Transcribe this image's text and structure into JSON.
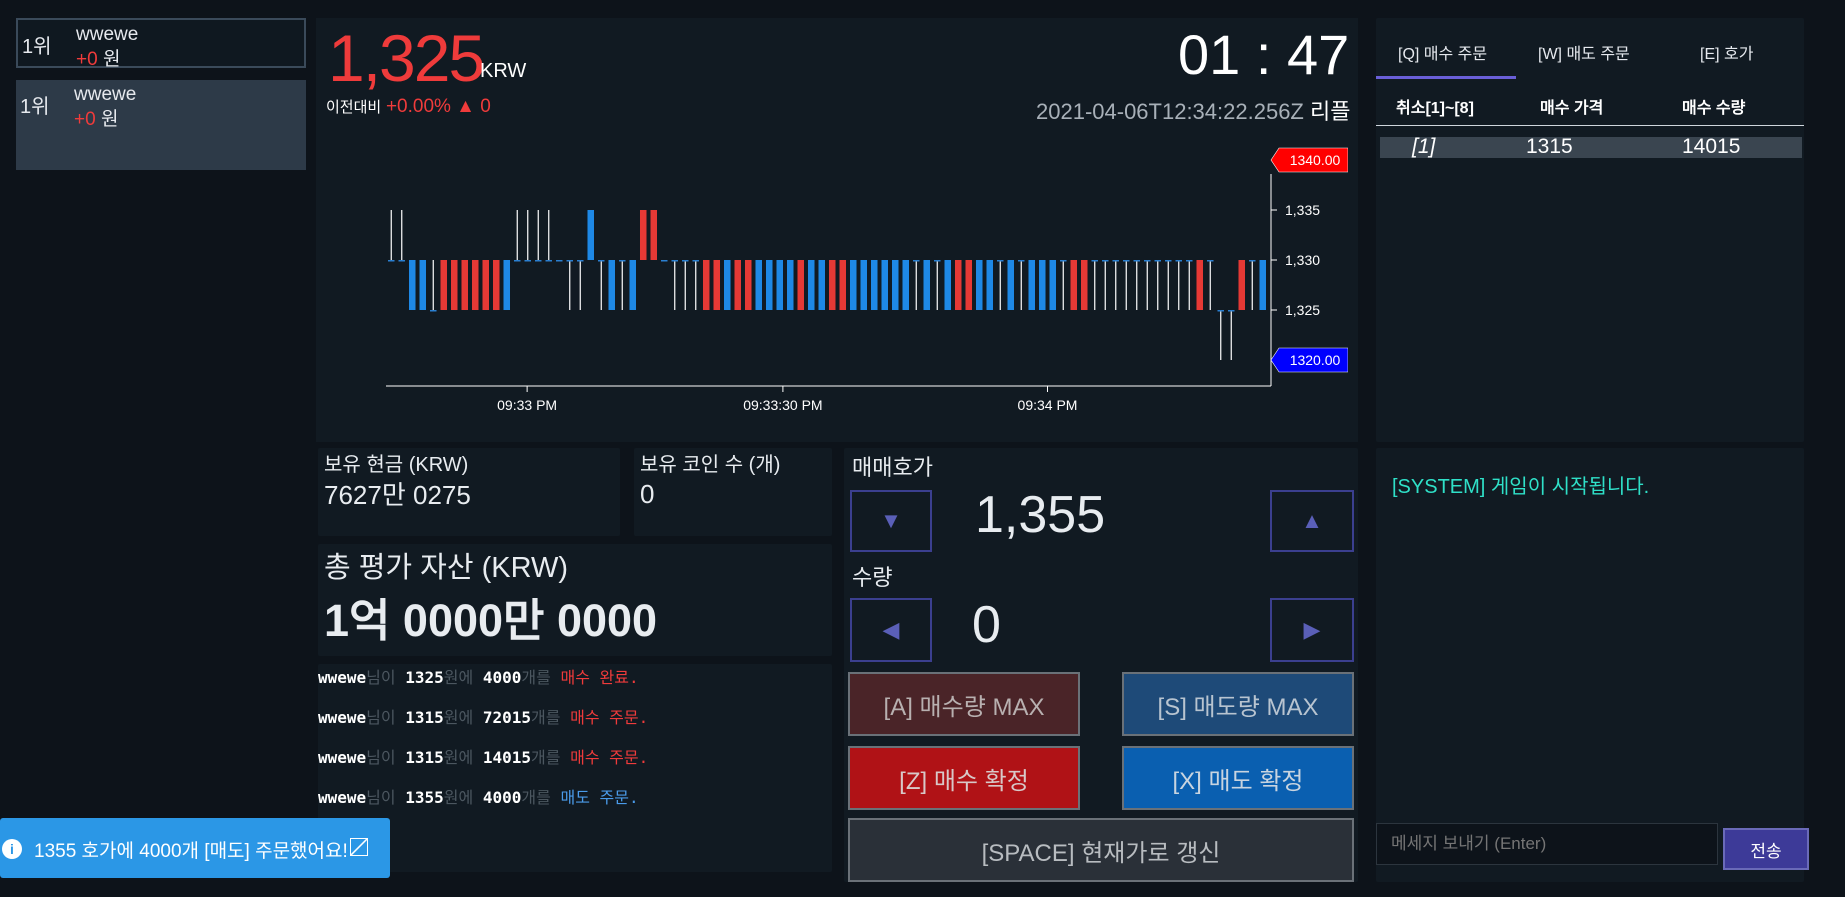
{
  "ranking": [
    {
      "rank": "1위",
      "name": "wwewe",
      "change": "+0",
      "unit": "원"
    },
    {
      "rank": "1위",
      "name": "wwewe",
      "change": "+0",
      "unit": "원"
    }
  ],
  "ticker": {
    "price": "1,325",
    "currency": "KRW",
    "prev_label": "이전대비",
    "prev_change": "+0.00% ▲ 0",
    "timer": "01 : 47",
    "timestamp": "2021-04-06T12:34:22.256Z",
    "coin_name": "리플"
  },
  "chart_data": {
    "type": "candlestick",
    "y_ticks": [
      "1,335",
      "1,330",
      "1,325"
    ],
    "x_ticks": [
      "09:33 PM",
      "09:33:30 PM",
      "09:34 PM"
    ],
    "ylim": [
      1318,
      1342
    ],
    "high_marker": "1340.00",
    "low_marker": "1320.00",
    "colors": {
      "up": "#e53935",
      "down": "#1e88e5",
      "neutral": "#ffffff"
    },
    "candles": [
      {
        "o": 1330,
        "c": 1330,
        "h": 1335,
        "l": 1330
      },
      {
        "o": 1330,
        "c": 1330,
        "h": 1335,
        "l": 1330
      },
      {
        "o": 1330,
        "c": 1325,
        "h": 1330,
        "l": 1325
      },
      {
        "o": 1330,
        "c": 1325,
        "h": 1330,
        "l": 1325
      },
      {
        "o": 1325,
        "c": 1325,
        "h": 1330,
        "l": 1325
      },
      {
        "o": 1325,
        "c": 1330,
        "h": 1330,
        "l": 1325
      },
      {
        "o": 1325,
        "c": 1330,
        "h": 1330,
        "l": 1325
      },
      {
        "o": 1325,
        "c": 1330,
        "h": 1330,
        "l": 1325
      },
      {
        "o": 1325,
        "c": 1330,
        "h": 1330,
        "l": 1325
      },
      {
        "o": 1325,
        "c": 1330,
        "h": 1330,
        "l": 1325
      },
      {
        "o": 1325,
        "c": 1330,
        "h": 1330,
        "l": 1325
      },
      {
        "o": 1330,
        "c": 1325,
        "h": 1330,
        "l": 1325
      },
      {
        "o": 1330,
        "c": 1330,
        "h": 1335,
        "l": 1330
      },
      {
        "o": 1330,
        "c": 1330,
        "h": 1335,
        "l": 1330
      },
      {
        "o": 1330,
        "c": 1330,
        "h": 1335,
        "l": 1330
      },
      {
        "o": 1330,
        "c": 1330,
        "h": 1335,
        "l": 1330
      },
      {
        "o": 1330,
        "c": 1330,
        "h": 1330,
        "l": 1330
      },
      {
        "o": 1330,
        "c": 1330,
        "h": 1330,
        "l": 1325
      },
      {
        "o": 1330,
        "c": 1330,
        "h": 1330,
        "l": 1325
      },
      {
        "o": 1335,
        "c": 1330,
        "h": 1335,
        "l": 1330
      },
      {
        "o": 1330,
        "c": 1330,
        "h": 1330,
        "l": 1325
      },
      {
        "o": 1330,
        "c": 1325,
        "h": 1330,
        "l": 1325
      },
      {
        "o": 1330,
        "c": 1330,
        "h": 1330,
        "l": 1325
      },
      {
        "o": 1330,
        "c": 1325,
        "h": 1330,
        "l": 1325
      },
      {
        "o": 1330,
        "c": 1335,
        "h": 1335,
        "l": 1330
      },
      {
        "o": 1330,
        "c": 1335,
        "h": 1335,
        "l": 1330
      },
      {
        "o": 1330,
        "c": 1330,
        "h": 1330,
        "l": 1330
      },
      {
        "o": 1330,
        "c": 1330,
        "h": 1330,
        "l": 1325
      },
      {
        "o": 1330,
        "c": 1330,
        "h": 1330,
        "l": 1325
      },
      {
        "o": 1330,
        "c": 1330,
        "h": 1330,
        "l": 1325
      },
      {
        "o": 1325,
        "c": 1330,
        "h": 1330,
        "l": 1325
      },
      {
        "o": 1325,
        "c": 1330,
        "h": 1330,
        "l": 1325
      },
      {
        "o": 1330,
        "c": 1325,
        "h": 1330,
        "l": 1325
      },
      {
        "o": 1325,
        "c": 1330,
        "h": 1330,
        "l": 1325
      },
      {
        "o": 1325,
        "c": 1330,
        "h": 1330,
        "l": 1325
      },
      {
        "o": 1330,
        "c": 1325,
        "h": 1330,
        "l": 1325
      },
      {
        "o": 1330,
        "c": 1325,
        "h": 1330,
        "l": 1325
      },
      {
        "o": 1330,
        "c": 1325,
        "h": 1330,
        "l": 1325
      },
      {
        "o": 1330,
        "c": 1325,
        "h": 1330,
        "l": 1325
      },
      {
        "o": 1325,
        "c": 1330,
        "h": 1330,
        "l": 1325
      },
      {
        "o": 1330,
        "c": 1325,
        "h": 1330,
        "l": 1325
      },
      {
        "o": 1330,
        "c": 1325,
        "h": 1330,
        "l": 1325
      },
      {
        "o": 1325,
        "c": 1330,
        "h": 1330,
        "l": 1325
      },
      {
        "o": 1325,
        "c": 1330,
        "h": 1330,
        "l": 1325
      },
      {
        "o": 1330,
        "c": 1325,
        "h": 1330,
        "l": 1325
      },
      {
        "o": 1330,
        "c": 1325,
        "h": 1330,
        "l": 1325
      },
      {
        "o": 1330,
        "c": 1325,
        "h": 1330,
        "l": 1325
      },
      {
        "o": 1330,
        "c": 1325,
        "h": 1330,
        "l": 1325
      },
      {
        "o": 1330,
        "c": 1325,
        "h": 1330,
        "l": 1325
      },
      {
        "o": 1330,
        "c": 1325,
        "h": 1330,
        "l": 1325
      },
      {
        "o": 1330,
        "c": 1330,
        "h": 1330,
        "l": 1325
      },
      {
        "o": 1330,
        "c": 1325,
        "h": 1330,
        "l": 1325
      },
      {
        "o": 1330,
        "c": 1330,
        "h": 1330,
        "l": 1325
      },
      {
        "o": 1330,
        "c": 1325,
        "h": 1330,
        "l": 1325
      },
      {
        "o": 1325,
        "c": 1330,
        "h": 1330,
        "l": 1325
      },
      {
        "o": 1325,
        "c": 1330,
        "h": 1330,
        "l": 1325
      },
      {
        "o": 1330,
        "c": 1325,
        "h": 1330,
        "l": 1325
      },
      {
        "o": 1330,
        "c": 1325,
        "h": 1330,
        "l": 1325
      },
      {
        "o": 1330,
        "c": 1330,
        "h": 1330,
        "l": 1325
      },
      {
        "o": 1330,
        "c": 1325,
        "h": 1330,
        "l": 1325
      },
      {
        "o": 1330,
        "c": 1330,
        "h": 1330,
        "l": 1325
      },
      {
        "o": 1330,
        "c": 1325,
        "h": 1330,
        "l": 1325
      },
      {
        "o": 1330,
        "c": 1325,
        "h": 1330,
        "l": 1325
      },
      {
        "o": 1330,
        "c": 1325,
        "h": 1330,
        "l": 1325
      },
      {
        "o": 1330,
        "c": 1330,
        "h": 1330,
        "l": 1325
      },
      {
        "o": 1325,
        "c": 1330,
        "h": 1330,
        "l": 1325
      },
      {
        "o": 1325,
        "c": 1330,
        "h": 1330,
        "l": 1325
      },
      {
        "o": 1330,
        "c": 1330,
        "h": 1330,
        "l": 1325
      },
      {
        "o": 1330,
        "c": 1330,
        "h": 1330,
        "l": 1325
      },
      {
        "o": 1330,
        "c": 1330,
        "h": 1330,
        "l": 1325
      },
      {
        "o": 1330,
        "c": 1330,
        "h": 1330,
        "l": 1325
      },
      {
        "o": 1330,
        "c": 1330,
        "h": 1330,
        "l": 1325
      },
      {
        "o": 1330,
        "c": 1330,
        "h": 1330,
        "l": 1325
      },
      {
        "o": 1330,
        "c": 1330,
        "h": 1330,
        "l": 1325
      },
      {
        "o": 1330,
        "c": 1330,
        "h": 1330,
        "l": 1325
      },
      {
        "o": 1330,
        "c": 1330,
        "h": 1330,
        "l": 1325
      },
      {
        "o": 1330,
        "c": 1330,
        "h": 1330,
        "l": 1325
      },
      {
        "o": 1325,
        "c": 1330,
        "h": 1330,
        "l": 1325
      },
      {
        "o": 1330,
        "c": 1330,
        "h": 1330,
        "l": 1325
      },
      {
        "o": 1325,
        "c": 1325,
        "h": 1325,
        "l": 1320
      },
      {
        "o": 1325,
        "c": 1325,
        "h": 1325,
        "l": 1320
      },
      {
        "o": 1325,
        "c": 1330,
        "h": 1330,
        "l": 1325
      },
      {
        "o": 1330,
        "c": 1330,
        "h": 1330,
        "l": 1325
      },
      {
        "o": 1330,
        "c": 1325,
        "h": 1330,
        "l": 1325
      }
    ]
  },
  "portfolio": {
    "cash_label": "보유 현금 (KRW)",
    "cash_value": "7627만 0275",
    "coins_label": "보유 코인 수 (개)",
    "coins_value": "0",
    "total_label": "총 평가 자산 (KRW)",
    "total_value": "1억 0000만 0000"
  },
  "logs": [
    {
      "user": "wwewe",
      "p1": "님이 ",
      "price": "1325",
      "p2": "원에 ",
      "qty": "4000",
      "p3": "개를 ",
      "action": "매수 완료.",
      "color": "#ef3b3b"
    },
    {
      "user": "wwewe",
      "p1": "님이 ",
      "price": "1315",
      "p2": "원에 ",
      "qty": "72015",
      "p3": "개를 ",
      "action": "매수 주문.",
      "color": "#ef3b3b"
    },
    {
      "user": "wwewe",
      "p1": "님이 ",
      "price": "1315",
      "p2": "원에 ",
      "qty": "14015",
      "p3": "개를 ",
      "action": "매수 주문.",
      "color": "#ef3b3b"
    },
    {
      "user": "wwewe",
      "p1": "님이 ",
      "price": "1355",
      "p2": "원에 ",
      "qty": "4000",
      "p3": "개를 ",
      "action": "매도 주문.",
      "color": "#4a9bea"
    }
  ],
  "trade": {
    "price_label": "매매호가",
    "price_value": "1,355",
    "qty_label": "수량",
    "qty_value": "0",
    "down_icon": "▼",
    "up_icon": "▲",
    "left_icon": "◀",
    "right_icon": "▶",
    "buy_max": "[A] 매수량 MAX",
    "sell_max": "[S] 매도량 MAX",
    "buy_confirm": "[Z] 매수 확정",
    "sell_confirm": "[X] 매도 확정",
    "refresh": "[SPACE] 현재가로 갱신"
  },
  "orderbook": {
    "tabs": [
      "[Q] 매수 주문",
      "[W] 매도 주문",
      "[E] 호가"
    ],
    "headers": [
      "취소[1]~[8]",
      "매수 가격",
      "매수 수량"
    ],
    "rows": [
      {
        "idx": "[1]",
        "price": "1315",
        "qty": "14015"
      }
    ]
  },
  "chat": {
    "messages": [
      "[SYSTEM] 게임이 시작됩니다."
    ],
    "placeholder": "메세지 보내기 (Enter)",
    "send": "전송"
  },
  "toast": {
    "message": "1355 호가에 4000개 [매도] 주문했어요!"
  }
}
